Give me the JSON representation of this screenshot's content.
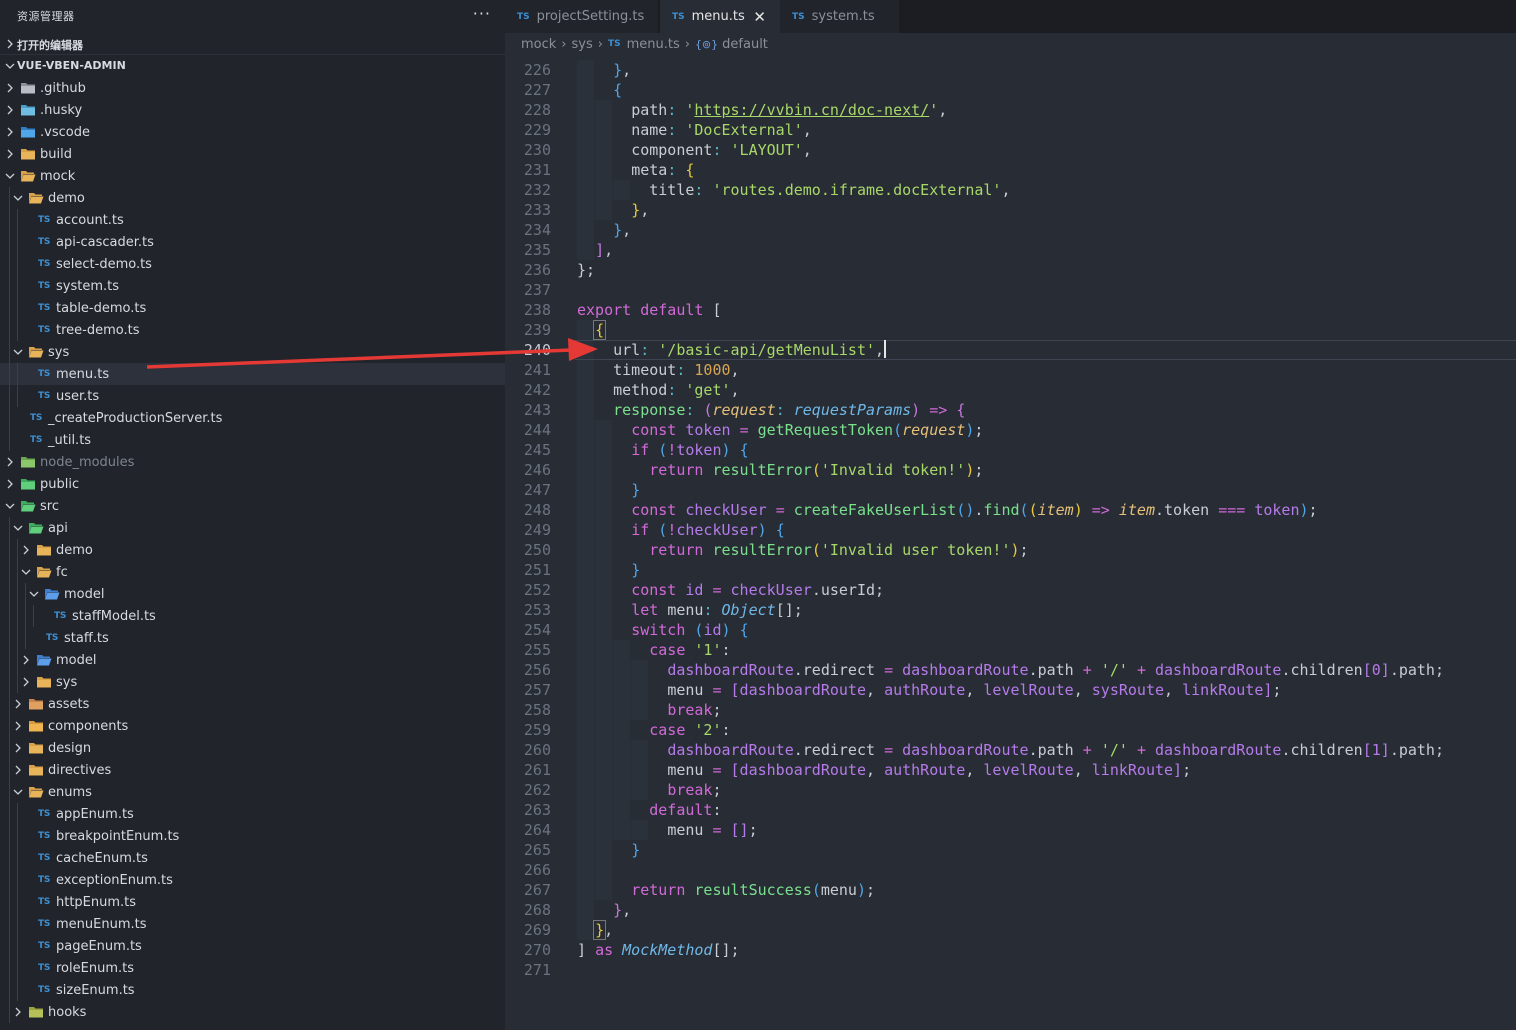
{
  "sidebar": {
    "title": "资源管理器",
    "more": "···",
    "open_editors": "打开的编辑器",
    "project": "VUE-VBEN-ADMIN",
    "tree": [
      {
        "label": ".github",
        "depth": 1,
        "kind": "folder",
        "icon": "github-folder-icon",
        "expanded": false
      },
      {
        "label": ".husky",
        "depth": 1,
        "kind": "folder",
        "icon": "husky-folder-icon",
        "expanded": false
      },
      {
        "label": ".vscode",
        "depth": 1,
        "kind": "folder",
        "icon": "vscode-folder-icon",
        "expanded": false
      },
      {
        "label": "build",
        "depth": 1,
        "kind": "folder",
        "icon": "folder-icon",
        "expanded": false
      },
      {
        "label": "mock",
        "depth": 1,
        "kind": "folder",
        "icon": "folder-open-icon",
        "expanded": true
      },
      {
        "label": "demo",
        "depth": 2,
        "kind": "folder",
        "icon": "folder-open-icon",
        "expanded": true
      },
      {
        "label": "account.ts",
        "depth": 3,
        "kind": "file"
      },
      {
        "label": "api-cascader.ts",
        "depth": 3,
        "kind": "file"
      },
      {
        "label": "select-demo.ts",
        "depth": 3,
        "kind": "file"
      },
      {
        "label": "system.ts",
        "depth": 3,
        "kind": "file"
      },
      {
        "label": "table-demo.ts",
        "depth": 3,
        "kind": "file"
      },
      {
        "label": "tree-demo.ts",
        "depth": 3,
        "kind": "file"
      },
      {
        "label": "sys",
        "depth": 2,
        "kind": "folder",
        "icon": "folder-open-icon",
        "expanded": true
      },
      {
        "label": "menu.ts",
        "depth": 3,
        "kind": "file",
        "selected": true
      },
      {
        "label": "user.ts",
        "depth": 3,
        "kind": "file"
      },
      {
        "label": "_createProductionServer.ts",
        "depth": 2,
        "kind": "file"
      },
      {
        "label": "_util.ts",
        "depth": 2,
        "kind": "file"
      },
      {
        "label": "node_modules",
        "depth": 1,
        "kind": "folder",
        "icon": "node-folder-icon",
        "expanded": false,
        "dim": true
      },
      {
        "label": "public",
        "depth": 1,
        "kind": "folder",
        "icon": "public-folder-icon",
        "expanded": false
      },
      {
        "label": "src",
        "depth": 1,
        "kind": "folder",
        "icon": "src-folder-icon",
        "expanded": true
      },
      {
        "label": "api",
        "depth": 2,
        "kind": "folder",
        "icon": "api-folder-icon",
        "expanded": true
      },
      {
        "label": "demo",
        "depth": 3,
        "kind": "folder",
        "icon": "folder-icon",
        "expanded": false
      },
      {
        "label": "fc",
        "depth": 3,
        "kind": "folder",
        "icon": "folder-open-icon",
        "expanded": true
      },
      {
        "label": "model",
        "depth": 4,
        "kind": "folder",
        "icon": "model-folder-icon",
        "expanded": true
      },
      {
        "label": "staffModel.ts",
        "depth": 5,
        "kind": "file"
      },
      {
        "label": "staff.ts",
        "depth": 4,
        "kind": "file"
      },
      {
        "label": "model",
        "depth": 3,
        "kind": "folder",
        "icon": "model-folder-icon",
        "expanded": false
      },
      {
        "label": "sys",
        "depth": 3,
        "kind": "folder",
        "icon": "folder-icon",
        "expanded": false
      },
      {
        "label": "assets",
        "depth": 2,
        "kind": "folder",
        "icon": "assets-folder-icon",
        "expanded": false
      },
      {
        "label": "components",
        "depth": 2,
        "kind": "folder",
        "icon": "components-folder-icon",
        "expanded": false
      },
      {
        "label": "design",
        "depth": 2,
        "kind": "folder",
        "icon": "folder-icon",
        "expanded": false
      },
      {
        "label": "directives",
        "depth": 2,
        "kind": "folder",
        "icon": "folder-icon",
        "expanded": false
      },
      {
        "label": "enums",
        "depth": 2,
        "kind": "folder",
        "icon": "folder-open-icon",
        "expanded": true
      },
      {
        "label": "appEnum.ts",
        "depth": 3,
        "kind": "file"
      },
      {
        "label": "breakpointEnum.ts",
        "depth": 3,
        "kind": "file"
      },
      {
        "label": "cacheEnum.ts",
        "depth": 3,
        "kind": "file"
      },
      {
        "label": "exceptionEnum.ts",
        "depth": 3,
        "kind": "file"
      },
      {
        "label": "httpEnum.ts",
        "depth": 3,
        "kind": "file"
      },
      {
        "label": "menuEnum.ts",
        "depth": 3,
        "kind": "file"
      },
      {
        "label": "pageEnum.ts",
        "depth": 3,
        "kind": "file"
      },
      {
        "label": "roleEnum.ts",
        "depth": 3,
        "kind": "file"
      },
      {
        "label": "sizeEnum.ts",
        "depth": 3,
        "kind": "file"
      },
      {
        "label": "hooks",
        "depth": 2,
        "kind": "folder",
        "icon": "hooks-folder-icon",
        "expanded": false
      }
    ]
  },
  "tabs": [
    {
      "badge": "TS",
      "label": "projectSetting.ts",
      "active": false
    },
    {
      "badge": "TS",
      "label": "menu.ts",
      "active": true,
      "close": "✕"
    },
    {
      "badge": "TS",
      "label": "system.ts",
      "active": false
    }
  ],
  "breadcrumb": {
    "parts": [
      "mock",
      "sys"
    ],
    "file_badge": "TS",
    "file": "menu.ts",
    "symbol_icon": "{⊚}",
    "symbol": "default"
  },
  "editor": {
    "current_line": 240,
    "lines": [
      {
        "n": 226,
        "html": "    <span class='c3'>}</span><span class='p'>,</span>"
      },
      {
        "n": 227,
        "html": "    <span class='c3'>{</span>"
      },
      {
        "n": 228,
        "html": "      <span class='p'>path</span><span class='cn'>:</span> <span class='s'>'</span><span class='su'>https://vvbin.cn/doc-next/</span><span class='s'>'</span><span class='p'>,</span>"
      },
      {
        "n": 229,
        "html": "      <span class='p'>name</span><span class='cn'>:</span> <span class='s'>'DocExternal'</span><span class='p'>,</span>"
      },
      {
        "n": 230,
        "html": "      <span class='p'>component</span><span class='cn'>:</span> <span class='s'>'LAYOUT'</span><span class='p'>,</span>"
      },
      {
        "n": 231,
        "html": "      <span class='p'>meta</span><span class='cn'>:</span> <span class='c1'>{</span>"
      },
      {
        "n": 232,
        "html": "        <span class='p'>title</span><span class='cn'>:</span> <span class='s'>'routes.demo.iframe.docExternal'</span><span class='p'>,</span>"
      },
      {
        "n": 233,
        "html": "      <span class='c1'>}</span><span class='p'>,</span>"
      },
      {
        "n": 234,
        "html": "    <span class='c3'>}</span><span class='p'>,</span>"
      },
      {
        "n": 235,
        "html": "  <span class='c2'>]</span><span class='p'>,</span>"
      },
      {
        "n": 236,
        "html": "<span class='p'>};</span>"
      },
      {
        "n": 237,
        "html": ""
      },
      {
        "n": 238,
        "html": "<span class='k'>export</span> <span class='k'>default</span> <span class='p'>[</span>"
      },
      {
        "n": 239,
        "html": "  <span class='c1 bx'>{</span>"
      },
      {
        "n": 240,
        "html": "    <span class='p'>url</span><span class='cn'>:</span> <span class='s'>'/basic-api/getMenuList'</span><span class='p'>,</span><span class='cursor'></span>"
      },
      {
        "n": 241,
        "html": "    <span class='p'>timeout</span><span class='cn'>:</span> <span class='n'>1000</span><span class='p'>,</span>"
      },
      {
        "n": 242,
        "html": "    <span class='p'>method</span><span class='cn'>:</span> <span class='s'>'get'</span><span class='p'>,</span>"
      },
      {
        "n": 243,
        "html": "    <span class='f'>response</span><span class='cn'>:</span> <span class='c2'>(</span><span class='prm'>request</span><span class='cn'>:</span> <span class='t'>requestParams</span><span class='c2'>)</span> <span class='o'>=&gt;</span> <span class='c2'>{</span>"
      },
      {
        "n": 244,
        "html": "      <span class='k'>const</span> <span class='pp'>token</span> <span class='o'>=</span> <span class='f'>getRequestToken</span><span class='c3'>(</span><span class='prm'>request</span><span class='c3'>)</span><span class='p'>;</span>"
      },
      {
        "n": 245,
        "html": "      <span class='k'>if</span> <span class='c3'>(</span><span class='o'>!</span><span class='pp'>token</span><span class='c3'>)</span> <span class='c3'>{</span>"
      },
      {
        "n": 246,
        "html": "        <span class='k'>return</span> <span class='f'>resultError</span><span class='c1'>(</span><span class='s'>'Invalid token!'</span><span class='c1'>)</span><span class='p'>;</span>"
      },
      {
        "n": 247,
        "html": "      <span class='c3'>}</span>"
      },
      {
        "n": 248,
        "html": "      <span class='k'>const</span> <span class='pp'>checkUser</span> <span class='o'>=</span> <span class='f'>createFakeUserList</span><span class='c3'>()</span><span class='p'>.</span><span class='f'>find</span><span class='c3'>(</span><span class='c1'>(</span><span class='prm'>item</span><span class='c1'>)</span> <span class='o'>=&gt;</span> <span class='prm'>item</span><span class='p'>.token</span> <span class='o'>===</span> <span class='pp'>token</span><span class='c3'>)</span><span class='p'>;</span>"
      },
      {
        "n": 249,
        "html": "      <span class='k'>if</span> <span class='c3'>(</span><span class='o'>!</span><span class='pp'>checkUser</span><span class='c3'>)</span> <span class='c3'>{</span>"
      },
      {
        "n": 250,
        "html": "        <span class='k'>return</span> <span class='f'>resultError</span><span class='c1'>(</span><span class='s'>'Invalid user token!'</span><span class='c1'>)</span><span class='p'>;</span>"
      },
      {
        "n": 251,
        "html": "      <span class='c3'>}</span>"
      },
      {
        "n": 252,
        "html": "      <span class='k'>const</span> <span class='pp'>id</span> <span class='o'>=</span> <span class='pp'>checkUser</span><span class='p'>.userId;</span>"
      },
      {
        "n": 253,
        "html": "      <span class='k'>let</span> <span class='p'>menu</span><span class='cn'>:</span> <span class='t'>Object</span><span class='p'>[];</span>"
      },
      {
        "n": 254,
        "html": "      <span class='k'>switch</span> <span class='c3'>(</span><span class='pp'>id</span><span class='c3'>)</span> <span class='c3'>{</span>"
      },
      {
        "n": 255,
        "html": "        <span class='k'>case</span> <span class='s'>'1'</span><span class='p'>:</span>"
      },
      {
        "n": 256,
        "html": "          <span class='pp'>dashboardRoute</span><span class='p'>.redirect</span> <span class='o'>=</span> <span class='pp'>dashboardRoute</span><span class='p'>.path</span> <span class='o'>+</span> <span class='s'>'/'</span> <span class='o'>+</span> <span class='pp'>dashboardRoute</span><span class='p'>.children</span><span class='pp'>[0]</span><span class='p'>.path;</span>"
      },
      {
        "n": 257,
        "html": "          <span class='p'>menu</span> <span class='o'>=</span> <span class='pp'>[dashboardRoute</span><span class='p'>,</span> <span class='pp'>authRoute</span><span class='p'>,</span> <span class='pp'>levelRoute</span><span class='p'>,</span> <span class='pp'>sysRoute</span><span class='p'>,</span> <span class='pp'>linkRoute]</span><span class='p'>;</span>"
      },
      {
        "n": 258,
        "html": "          <span class='k'>break</span><span class='p'>;</span>"
      },
      {
        "n": 259,
        "html": "        <span class='k'>case</span> <span class='s'>'2'</span><span class='p'>:</span>"
      },
      {
        "n": 260,
        "html": "          <span class='pp'>dashboardRoute</span><span class='p'>.redirect</span> <span class='o'>=</span> <span class='pp'>dashboardRoute</span><span class='p'>.path</span> <span class='o'>+</span> <span class='s'>'/'</span> <span class='o'>+</span> <span class='pp'>dashboardRoute</span><span class='p'>.children</span><span class='pp'>[1]</span><span class='p'>.path;</span>"
      },
      {
        "n": 261,
        "html": "          <span class='p'>menu</span> <span class='o'>=</span> <span class='pp'>[dashboardRoute</span><span class='p'>,</span> <span class='pp'>authRoute</span><span class='p'>,</span> <span class='pp'>levelRoute</span><span class='p'>,</span> <span class='pp'>linkRoute]</span><span class='p'>;</span>"
      },
      {
        "n": 262,
        "html": "          <span class='k'>break</span><span class='p'>;</span>"
      },
      {
        "n": 263,
        "html": "        <span class='k'>default</span><span class='p'>:</span>"
      },
      {
        "n": 264,
        "html": "          <span class='p'>menu</span> <span class='o'>=</span> <span class='pp'>[]</span><span class='p'>;</span>"
      },
      {
        "n": 265,
        "html": "      <span class='c3'>}</span>"
      },
      {
        "n": 266,
        "html": ""
      },
      {
        "n": 267,
        "html": "      <span class='k'>return</span> <span class='f'>resultSuccess</span><span class='c3'>(</span><span class='p'>menu</span><span class='c3'>)</span><span class='p'>;</span>"
      },
      {
        "n": 268,
        "html": "    <span class='c2'>}</span><span class='p'>,</span>"
      },
      {
        "n": 269,
        "html": "  <span class='c1 bx'>}</span><span class='p'>,</span>"
      },
      {
        "n": 270,
        "html": "<span class='p'>]</span> <span class='k'>as</span> <span class='t'>MockMethod</span><span class='p'>[];</span>"
      },
      {
        "n": 271,
        "html": ""
      }
    ]
  },
  "annotation": {
    "color": "#e53935"
  }
}
